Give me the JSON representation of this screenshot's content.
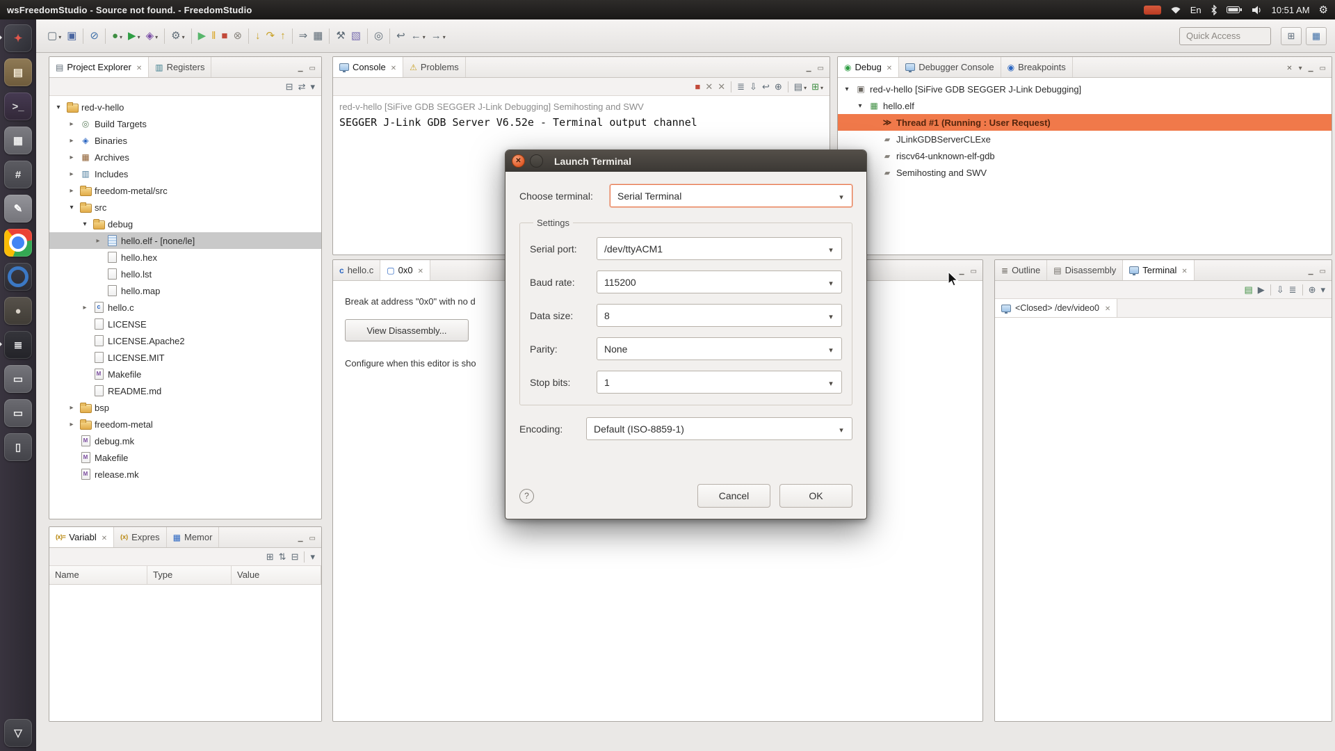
{
  "system_bar": {
    "title": "wsFreedomStudio - Source not found. - FreedomStudio",
    "keyboard_indicator": "En",
    "time": "10:51 AM"
  },
  "dock": {
    "items": [
      {
        "name": "freedom-studio-launcher-icon",
        "glyph": "✦",
        "bg": "linear-gradient(135deg,#4A4A52,#2D2D34)",
        "fg": "#E2574C",
        "active": true,
        "cls": "active"
      },
      {
        "name": "files-icon",
        "glyph": "▤",
        "bg": "linear-gradient(#8F7A55,#6E5B3C)",
        "fg": "#F5EBD7"
      },
      {
        "name": "terminal-icon",
        "glyph": ">_",
        "bg": "linear-gradient(#463A52,#322838)",
        "fg": "#D9D9D9"
      },
      {
        "name": "archive-manager-icon",
        "glyph": "▦",
        "bg": "linear-gradient(#7D7D83,#5E5E64)",
        "fg": "#F0F0F0"
      },
      {
        "name": "calculator-icon",
        "glyph": "#",
        "bg": "linear-gradient(#5C5C62,#45454B)",
        "fg": "#EDEDED"
      },
      {
        "name": "text-editor-icon",
        "glyph": "✎",
        "bg": "linear-gradient(#94949A,#74747A)",
        "fg": "#FFFFFF"
      },
      {
        "name": "chrome-icon",
        "glyph": "",
        "bg": "#FFFFFF",
        "fg": "#FFFFFF",
        "cls": "chrome"
      },
      {
        "name": "video-player-icon",
        "glyph": "",
        "bg": "linear-gradient(#3C3C44,#2C2C33)",
        "fg": "#FFFFFF",
        "cls": "ring"
      },
      {
        "name": "gimp-icon",
        "glyph": "●",
        "bg": "linear-gradient(#57524B,#403C36)",
        "fg": "#D9D2C8"
      },
      {
        "name": "segger-tools-icon",
        "glyph": "≣",
        "bg": "linear-gradient(#35353B,#232328)",
        "fg": "#FFFFFF",
        "active": true,
        "cls": "active"
      },
      {
        "name": "disk-utility-icon",
        "glyph": "▭",
        "bg": "linear-gradient(#75757B,#58585E)",
        "fg": "#EDEDED"
      },
      {
        "name": "backup-drive-icon",
        "glyph": "▭",
        "bg": "linear-gradient(#6B6B71,#505056)",
        "fg": "#EDEDED"
      },
      {
        "name": "mobile-device-icon",
        "glyph": "▯",
        "bg": "linear-gradient(#5A5A60,#434349)",
        "fg": "#EDEDED"
      },
      {
        "name": "trash-icon",
        "glyph": "▽",
        "bg": "linear-gradient(#4B4B51,#36363C)",
        "fg": "#E6E6E6",
        "cls": "trash"
      }
    ]
  },
  "main_toolbar": {
    "quick_access": "Quick Access",
    "icons": [
      {
        "name": "new-button",
        "glyph": "▢",
        "color": "#5E6B76",
        "caret": true
      },
      {
        "name": "save-button",
        "glyph": "▣",
        "color": "#4A66A0"
      },
      {
        "sep": true
      },
      {
        "name": "skip-all-breakpoints-button",
        "glyph": "⊘",
        "color": "#3E6FA8"
      },
      {
        "sep": true
      },
      {
        "name": "debug-button",
        "glyph": "●",
        "color": "#3E8E41",
        "caret": true
      },
      {
        "name": "run-button",
        "glyph": "▶",
        "color": "#2F9E44",
        "caret": true
      },
      {
        "name": "profile-button",
        "glyph": "◈",
        "color": "#7B4FA6",
        "caret": true
      },
      {
        "sep": true
      },
      {
        "name": "external-tools-button",
        "glyph": "⚙",
        "color": "#5E6B76",
        "caret": true
      },
      {
        "sep": true
      },
      {
        "name": "resume-button",
        "glyph": "▶",
        "color": "#58B66B"
      },
      {
        "name": "suspend-button",
        "glyph": "‖",
        "color": "#D9A21B"
      },
      {
        "name": "terminate-button",
        "glyph": "■",
        "color": "#C24A3A"
      },
      {
        "name": "disconnect-button",
        "glyph": "⊗",
        "color": "#8A867F"
      },
      {
        "sep": true
      },
      {
        "name": "step-into-button",
        "glyph": "↓",
        "color": "#C9A227"
      },
      {
        "name": "step-over-button",
        "glyph": "↷",
        "color": "#C9A227"
      },
      {
        "name": "step-return-button",
        "glyph": "↑",
        "color": "#C9A227"
      },
      {
        "sep": true
      },
      {
        "name": "instruction-stepping-button",
        "glyph": "⇒",
        "color": "#5E6B76"
      },
      {
        "name": "memory-view-button",
        "glyph": "▦",
        "color": "#5E6B76"
      },
      {
        "sep": true
      },
      {
        "name": "build-button",
        "glyph": "⚒",
        "color": "#5E6B76"
      },
      {
        "name": "new-c-project-button",
        "glyph": "▧",
        "color": "#7A6FB0"
      },
      {
        "sep": true
      },
      {
        "name": "search-button",
        "glyph": "◎",
        "color": "#5E6B76"
      },
      {
        "sep": true
      },
      {
        "name": "last-edit-location-button",
        "glyph": "↩",
        "color": "#5E6B76"
      },
      {
        "name": "back-button",
        "glyph": "←",
        "color": "#5E6B76",
        "caret": true
      },
      {
        "name": "forward-button",
        "glyph": "→",
        "color": "#5E6B76",
        "caret": true
      }
    ]
  },
  "project_explorer": {
    "tabs": [
      "Project Explorer",
      "Registers"
    ],
    "toolbar": [
      {
        "name": "collapse-all-button",
        "glyph": "⊟",
        "color": "#5E6B76"
      },
      {
        "name": "link-with-editor-button",
        "glyph": "⇄",
        "color": "#5E6B76"
      },
      {
        "name": "view-menu-button",
        "glyph": "▾",
        "color": "#5E6B76"
      }
    ],
    "tree": [
      {
        "depth": 0,
        "arrow": "expanded",
        "icon": "project",
        "label": "red-v-hello"
      },
      {
        "depth": 1,
        "arrow": "collapsed",
        "icon": "targets",
        "label": "Build Targets"
      },
      {
        "depth": 1,
        "arrow": "collapsed",
        "icon": "binaries",
        "label": "Binaries"
      },
      {
        "depth": 1,
        "arrow": "collapsed",
        "icon": "archives",
        "label": "Archives"
      },
      {
        "depth": 1,
        "arrow": "collapsed",
        "icon": "includes",
        "label": "Includes"
      },
      {
        "depth": 1,
        "arrow": "collapsed",
        "icon": "folder",
        "label": "freedom-metal/src"
      },
      {
        "depth": 1,
        "arrow": "expanded",
        "icon": "folder",
        "label": "src"
      },
      {
        "depth": 2,
        "arrow": "expanded",
        "icon": "folder",
        "label": "debug"
      },
      {
        "depth": 3,
        "arrow": "collapsed",
        "icon": "binfile",
        "label": "hello.elf - [none/le]",
        "state": "selected"
      },
      {
        "depth": 3,
        "arrow": "leaf",
        "icon": "file",
        "label": "hello.hex"
      },
      {
        "depth": 3,
        "arrow": "leaf",
        "icon": "file",
        "label": "hello.lst"
      },
      {
        "depth": 3,
        "arrow": "leaf",
        "icon": "file",
        "label": "hello.map"
      },
      {
        "depth": 2,
        "arrow": "collapsed",
        "icon": "cfile",
        "label": "hello.c"
      },
      {
        "depth": 2,
        "arrow": "leaf",
        "icon": "file",
        "label": "LICENSE"
      },
      {
        "depth": 2,
        "arrow": "leaf",
        "icon": "file",
        "label": "LICENSE.Apache2"
      },
      {
        "depth": 2,
        "arrow": "leaf",
        "icon": "file",
        "label": "LICENSE.MIT"
      },
      {
        "depth": 2,
        "arrow": "leaf",
        "icon": "mkfile",
        "label": "Makefile"
      },
      {
        "depth": 2,
        "arrow": "leaf",
        "icon": "file",
        "label": "README.md"
      },
      {
        "depth": 1,
        "arrow": "collapsed",
        "icon": "folder",
        "label": "bsp"
      },
      {
        "depth": 1,
        "arrow": "collapsed",
        "icon": "folder",
        "label": "freedom-metal"
      },
      {
        "depth": 1,
        "arrow": "leaf",
        "icon": "mkfile",
        "label": "debug.mk"
      },
      {
        "depth": 1,
        "arrow": "leaf",
        "icon": "mkfile",
        "label": "Makefile"
      },
      {
        "depth": 1,
        "arrow": "leaf",
        "icon": "mkfile",
        "label": "release.mk"
      }
    ]
  },
  "console": {
    "tabs": [
      "Console",
      "Problems"
    ],
    "toolbar": [
      {
        "name": "terminate-button",
        "glyph": "■",
        "color": "#C24A3A"
      },
      {
        "name": "remove-launch-button",
        "glyph": "✕",
        "color": "#8A867F"
      },
      {
        "name": "remove-all-terminated-button",
        "glyph": "✕",
        "color": "#8A867F"
      },
      {
        "sep": true
      },
      {
        "name": "clear-console-button",
        "glyph": "≣",
        "color": "#5E6B76"
      },
      {
        "name": "scroll-lock-button",
        "glyph": "⇩",
        "color": "#5E6B76"
      },
      {
        "name": "word-wrap-button",
        "glyph": "↩",
        "color": "#5E6B76"
      },
      {
        "name": "pin-console-button",
        "glyph": "⊕",
        "color": "#5E6B76"
      },
      {
        "sep": true
      },
      {
        "name": "display-selected-console-button",
        "glyph": "▤",
        "color": "#5E6B76",
        "caret": true
      },
      {
        "name": "open-console-button",
        "glyph": "⊞",
        "color": "#3E8E41",
        "caret": true
      }
    ],
    "header_line": "red-v-hello [SiFive GDB SEGGER J-Link Debugging] Semihosting and SWV",
    "output_line": "SEGGER J-Link GDB Server V6.52e - Terminal output channel"
  },
  "debug": {
    "tabs": [
      "Debug",
      "Debugger Console",
      "Breakpoints"
    ],
    "tree": [
      {
        "depth": 0,
        "arrow": "expanded",
        "icon": "launch",
        "label": "red-v-hello [SiFive GDB SEGGER J-Link Debugging]"
      },
      {
        "depth": 1,
        "arrow": "expanded",
        "icon": "target",
        "label": "hello.elf"
      },
      {
        "depth": 2,
        "arrow": "leaf",
        "icon": "thread",
        "label": "Thread #1 (Running : User Request)",
        "state": "selected"
      },
      {
        "depth": 2,
        "arrow": "leaf",
        "icon": "process",
        "label": "JLinkGDBServerCLExe"
      },
      {
        "depth": 2,
        "arrow": "leaf",
        "icon": "process",
        "label": "riscv64-unknown-elf-gdb"
      },
      {
        "depth": 2,
        "arrow": "leaf",
        "icon": "process",
        "label": "Semihosting and SWV"
      }
    ]
  },
  "editor": {
    "tabs": [
      "hello.c",
      "0x0"
    ],
    "message_line": "Break at address \"0x0\" with no d",
    "button_label": "View Disassembly...",
    "config_line": "Configure when this editor is sho"
  },
  "right_panel": {
    "tabs": [
      "Outline",
      "Disassembly",
      "Terminal"
    ],
    "toolbar": [
      {
        "name": "open-terminal-button",
        "glyph": "▤",
        "color": "#3E8E41"
      },
      {
        "name": "connect-terminal-button",
        "glyph": "▶",
        "color": "#5E6B76"
      },
      {
        "sep": true
      },
      {
        "name": "scroll-lock-button",
        "glyph": "⇩",
        "color": "#5E6B76"
      },
      {
        "name": "clear-terminal-button",
        "glyph": "≣",
        "color": "#5E6B76"
      },
      {
        "sep": true
      },
      {
        "name": "pin-terminal-button",
        "glyph": "⊕",
        "color": "#5E6B76"
      },
      {
        "name": "view-menu-button",
        "glyph": "▾",
        "color": "#5E6B76"
      }
    ],
    "terminal_tab": "<Closed> /dev/video0"
  },
  "variables": {
    "tabs": [
      "Variabl",
      "Expres",
      "Memor"
    ],
    "toolbar": [
      {
        "name": "show-type-names-button",
        "glyph": "⊞",
        "color": "#5E6B76"
      },
      {
        "name": "show-logical-structure-button",
        "glyph": "⇅",
        "color": "#5E6B76"
      },
      {
        "name": "collapse-all-button",
        "glyph": "⊟",
        "color": "#5E6B76"
      },
      {
        "sep": true
      },
      {
        "name": "view-menu-button",
        "glyph": "▾",
        "color": "#5E6B76"
      }
    ],
    "columns": [
      "Name",
      "Type",
      "Value"
    ]
  },
  "dialog": {
    "title": "Launch Terminal",
    "choose_label": "Choose terminal:",
    "choose_value": "Serial Terminal",
    "settings_label": "Settings",
    "settings_rows": [
      {
        "label": "Serial port:",
        "value": "/dev/ttyACM1"
      },
      {
        "label": "Baud rate:",
        "value": "115200"
      },
      {
        "label": "Data size:",
        "value": "8"
      },
      {
        "label": "Parity:",
        "value": "None"
      },
      {
        "label": "Stop bits:",
        "value": "1"
      }
    ],
    "encoding_label": "Encoding:",
    "encoding_value": "Default (ISO-8859-1)",
    "help_glyph": "?",
    "cancel_label": "Cancel",
    "ok_label": "OK"
  }
}
